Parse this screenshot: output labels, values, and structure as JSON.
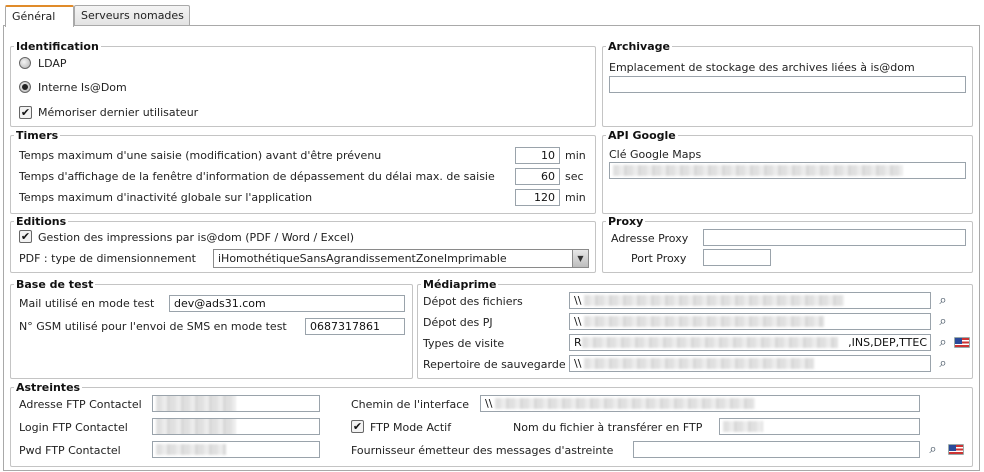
{
  "tabs": [
    {
      "label": "Général",
      "active": true
    },
    {
      "label": "Serveurs nomades",
      "active": false
    }
  ],
  "identification": {
    "legend": "Identification",
    "options": [
      {
        "label": "LDAP",
        "checked": false
      },
      {
        "label": "Interne Is@Dom",
        "checked": true
      }
    ],
    "memoriser_label": "Mémoriser dernier utilisateur",
    "memoriser_checked": true
  },
  "archivage": {
    "legend": "Archivage",
    "label": "Emplacement de stockage des archives liées à is@dom",
    "value": ""
  },
  "timers": {
    "legend": "Timers",
    "rows": [
      {
        "label": "Temps maximum d'une saisie (modification) avant d'être prévenu",
        "value": "10",
        "unit": "min"
      },
      {
        "label": "Temps d'affichage de la fenêtre d'information de dépassement du délai max. de saisie",
        "value": "60",
        "unit": "sec"
      },
      {
        "label": "Temps maximum d'inactivité globale sur l'application",
        "value": "120",
        "unit": "min"
      }
    ]
  },
  "api_google": {
    "legend": "API Google",
    "label": "Clé Google Maps"
  },
  "editions": {
    "legend": "Editions",
    "gestion_label": "Gestion des impressions par is@dom (PDF / Word / Excel)",
    "gestion_checked": true,
    "pdf_label": "PDF : type de dimensionnement",
    "pdf_value": "iHomothétiqueSansAgrandissementZoneImprimable"
  },
  "proxy": {
    "legend": "Proxy",
    "adresse_label": "Adresse Proxy",
    "adresse_value": "",
    "port_label": "Port Proxy",
    "port_value": ""
  },
  "base_test": {
    "legend": "Base de test",
    "mail_label": "Mail utilisé en mode test",
    "mail_value": "dev@ads31.com",
    "gsm_label": "N° GSM utilisé pour l'envoi de SMS en mode test",
    "gsm_value": "0687317861"
  },
  "mediaprime": {
    "legend": "Médiaprime",
    "fichiers_label": "Dépot des fichiers",
    "fichiers_value": "\\\\",
    "pj_label": "Dépot des PJ",
    "pj_value": "\\\\",
    "visite_label": "Types de visite",
    "visite_prefix": "R",
    "visite_suffix": ",INS,DEP,TTEC",
    "sauvegarde_label": "Repertoire de sauvegarde",
    "sauvegarde_value": "\\\\"
  },
  "astreintes": {
    "legend": "Astreintes",
    "adresse_label": "Adresse FTP Contactel",
    "login_label": "Login FTP Contactel",
    "pwd_label": "Pwd FTP Contactel",
    "chemin_label": "Chemin de l'interface",
    "chemin_value": "\\\\",
    "ftp_mode_label": "FTP Mode Actif",
    "ftp_mode_checked": true,
    "nom_fichier_label": "Nom du fichier à transférer en FTP",
    "fournisseur_label": "Fournisseur émetteur des messages d'astreinte",
    "fournisseur_value": ""
  },
  "icons": {
    "browse": "binoculars-icon",
    "language": "us-flag-icon"
  }
}
